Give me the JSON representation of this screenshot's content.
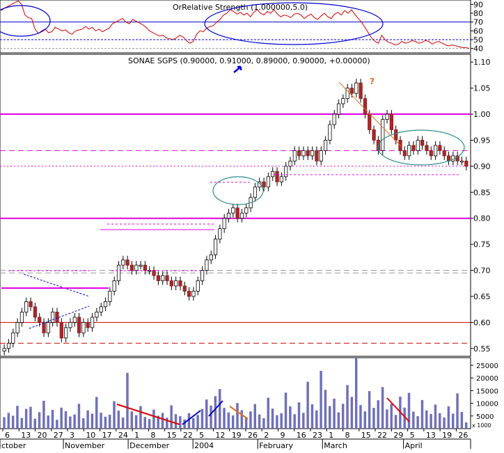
{
  "chart_data": [
    {
      "type": "line",
      "panel": "indicator",
      "title": "OrRelative Strength (1.000000,5.0)",
      "y_ticks": [
        40,
        50,
        60,
        70,
        80,
        90
      ],
      "ylim": [
        35,
        95
      ],
      "guide_levels": [
        70,
        50,
        40
      ],
      "series": [
        {
          "values": [
            83,
            86,
            88,
            90,
            92,
            94,
            90,
            78,
            75,
            74,
            62,
            57,
            60,
            62,
            58,
            59,
            64,
            62,
            60,
            61,
            58,
            56,
            60,
            61,
            62,
            65,
            62,
            64,
            60,
            62,
            59,
            61,
            63,
            68,
            70,
            72,
            74,
            70,
            68,
            73,
            71,
            69,
            67,
            64,
            60,
            58,
            56,
            54,
            55,
            52,
            51,
            50,
            52,
            55,
            53,
            49,
            46,
            48,
            56,
            60,
            59,
            63,
            65,
            66,
            70,
            73,
            78,
            80,
            84,
            82,
            79,
            81,
            78,
            80,
            76,
            81,
            84,
            80,
            78,
            82,
            80,
            84,
            79,
            76,
            78,
            77,
            75,
            79,
            80,
            78,
            74,
            77,
            79,
            75,
            73,
            77,
            80,
            76,
            74,
            79,
            81,
            78,
            83,
            80,
            84,
            79,
            74,
            70,
            64,
            58,
            52,
            48,
            46,
            55,
            50,
            47,
            46,
            44,
            45,
            48,
            46,
            47,
            49,
            48,
            46,
            47,
            49,
            48,
            45,
            47,
            48,
            46,
            44,
            43,
            44,
            43,
            42,
            41,
            41,
            40
          ]
        }
      ]
    },
    {
      "type": "candlestick",
      "panel": "price",
      "title": "SONAE SGPS (0.90000, 0.91000, 0.89000, 0.90000, +0.00000)",
      "y_ticks": [
        0.55,
        0.6,
        0.65,
        0.7,
        0.75,
        0.8,
        0.85,
        0.9,
        0.95,
        1.0,
        1.05,
        1.1
      ],
      "ylim": [
        0.535,
        1.115
      ],
      "horizontal_levels": [
        {
          "value": 1.0,
          "color": "#e000e0",
          "style": "solid"
        },
        {
          "value": 0.93,
          "color": "#e000e0",
          "style": "dashed"
        },
        {
          "value": 0.9,
          "color": "#e000e0",
          "style": "dotted"
        },
        {
          "value": 0.8,
          "color": "#e000e0",
          "style": "solid"
        },
        {
          "value": 0.7,
          "color": "#999999",
          "style": "dashed"
        },
        {
          "value": 0.695,
          "color": "#999999",
          "style": "dashed"
        },
        {
          "value": 0.6,
          "color": "#cc0000",
          "style": "solid"
        },
        {
          "value": 0.56,
          "color": "#cc0000",
          "style": "dashed"
        }
      ],
      "annotation_marks": [
        "?"
      ],
      "closes": [
        0.55,
        0.56,
        0.58,
        0.6,
        0.62,
        0.64,
        0.63,
        0.61,
        0.6,
        0.58,
        0.6,
        0.62,
        0.6,
        0.57,
        0.59,
        0.6,
        0.61,
        0.58,
        0.6,
        0.59,
        0.61,
        0.62,
        0.63,
        0.64,
        0.66,
        0.68,
        0.71,
        0.72,
        0.71,
        0.7,
        0.71,
        0.71,
        0.7,
        0.7,
        0.69,
        0.68,
        0.69,
        0.68,
        0.67,
        0.68,
        0.67,
        0.66,
        0.65,
        0.66,
        0.68,
        0.7,
        0.72,
        0.73,
        0.76,
        0.78,
        0.8,
        0.81,
        0.82,
        0.8,
        0.81,
        0.82,
        0.84,
        0.86,
        0.87,
        0.86,
        0.88,
        0.89,
        0.87,
        0.88,
        0.9,
        0.91,
        0.93,
        0.92,
        0.93,
        0.92,
        0.93,
        0.91,
        0.93,
        0.95,
        0.98,
        1.0,
        1.02,
        1.03,
        1.05,
        1.04,
        1.06,
        1.03,
        1.0,
        0.97,
        0.95,
        0.93,
        0.99,
        1.0,
        0.97,
        0.95,
        0.93,
        0.92,
        0.94,
        0.93,
        0.95,
        0.94,
        0.93,
        0.92,
        0.94,
        0.93,
        0.92,
        0.91,
        0.92,
        0.91,
        0.91,
        0.9
      ]
    },
    {
      "type": "bar",
      "panel": "volume",
      "y_ticks": [
        "25000",
        "20000",
        "15000",
        "10000",
        "5000"
      ],
      "y_tick_values": [
        25000,
        20000,
        15000,
        10000,
        5000
      ],
      "unit_label": "x 1000",
      "ylim": [
        0,
        28000
      ],
      "x_tick_labels": [
        "6",
        "13",
        "20",
        "27",
        "3",
        "10",
        "17",
        "24",
        "1",
        "8",
        "15",
        "22",
        "5",
        "12",
        "19",
        "26",
        "2",
        "9",
        "16",
        "23",
        "1",
        "8",
        "15",
        "22",
        "29",
        "5",
        "13",
        "19",
        "26"
      ],
      "month_labels": [
        "ctober",
        "November",
        "December",
        "2004",
        "February",
        "March",
        "April"
      ],
      "values": [
        4500,
        6200,
        5100,
        9000,
        4200,
        7800,
        8600,
        3900,
        6500,
        11000,
        5200,
        7400,
        3500,
        8300,
        6900,
        4800,
        5600,
        9800,
        4100,
        7200,
        5900,
        12500,
        6300,
        4700,
        5500,
        10800,
        7100,
        4400,
        22000,
        6800,
        5300,
        8900,
        4600,
        3800,
        7500,
        5100,
        6200,
        4300,
        9200,
        5700,
        4900,
        3600,
        6100,
        4200,
        5400,
        7800,
        11500,
        9100,
        12800,
        15600,
        8200,
        6400,
        5200,
        10100,
        7300,
        4500,
        6800,
        9700,
        5600,
        4100,
        12200,
        7900,
        5300,
        6100,
        14200,
        8800,
        5700,
        10400,
        6200,
        18500,
        9600,
        7200,
        22800,
        15300,
        8900,
        11800,
        6400,
        9800,
        17200,
        12500,
        28000,
        9300,
        6800,
        14800,
        8200,
        11200,
        16400,
        7600,
        9800,
        5400,
        12600,
        8300,
        14100,
        6700,
        4900,
        11300,
        7200,
        5800,
        9500,
        6100,
        4400,
        8800,
        5900,
        13900,
        6600,
        2500
      ]
    }
  ]
}
